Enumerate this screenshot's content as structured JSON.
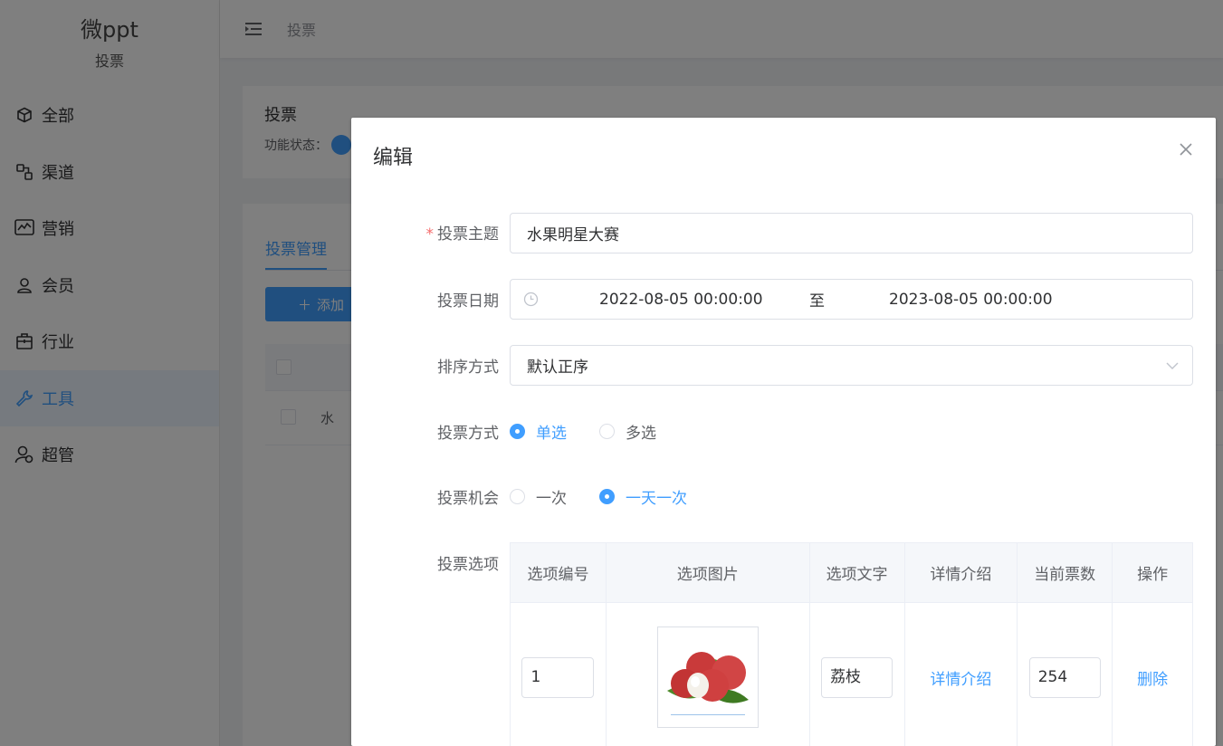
{
  "sidebar": {
    "brand_title": "微ppt",
    "brand_sub": "投票",
    "items": [
      {
        "label": "全部",
        "icon": "cube-icon"
      },
      {
        "label": "渠道",
        "icon": "channel-icon"
      },
      {
        "label": "营销",
        "icon": "chart-icon"
      },
      {
        "label": "会员",
        "icon": "user-icon"
      },
      {
        "label": "行业",
        "icon": "briefcase-icon"
      },
      {
        "label": "工具",
        "icon": "wrench-icon",
        "active": true
      },
      {
        "label": "超管",
        "icon": "admin-icon"
      }
    ]
  },
  "header": {
    "breadcrumb": "投票"
  },
  "main": {
    "card_title": "投票",
    "status_label": "功能状态：",
    "tab_label": "投票管理",
    "add_button": "添加",
    "row_text": "水"
  },
  "dialog": {
    "title": "编辑",
    "fields": {
      "theme_label": "投票主题",
      "theme_value": "水果明星大赛",
      "date_label": "投票日期",
      "date_start": "2022-08-05 00:00:00",
      "date_sep": "至",
      "date_end": "2023-08-05 00:00:00",
      "sort_label": "排序方式",
      "sort_value": "默认正序",
      "mode_label": "投票方式",
      "mode_single": "单选",
      "mode_multi": "多选",
      "chance_label": "投票机会",
      "chance_once": "一次",
      "chance_daily": "一天一次",
      "options_label": "投票选项"
    },
    "options_table": {
      "headers": [
        "选项编号",
        "选项图片",
        "选项文字",
        "详情介绍",
        "当前票数",
        "操作"
      ],
      "rows": [
        {
          "number": "1",
          "text": "荔枝",
          "detail": "详情介绍",
          "votes": "254",
          "action": "删除"
        }
      ]
    }
  },
  "colors": {
    "primary": "#409eff",
    "required": "#f56c6c"
  }
}
